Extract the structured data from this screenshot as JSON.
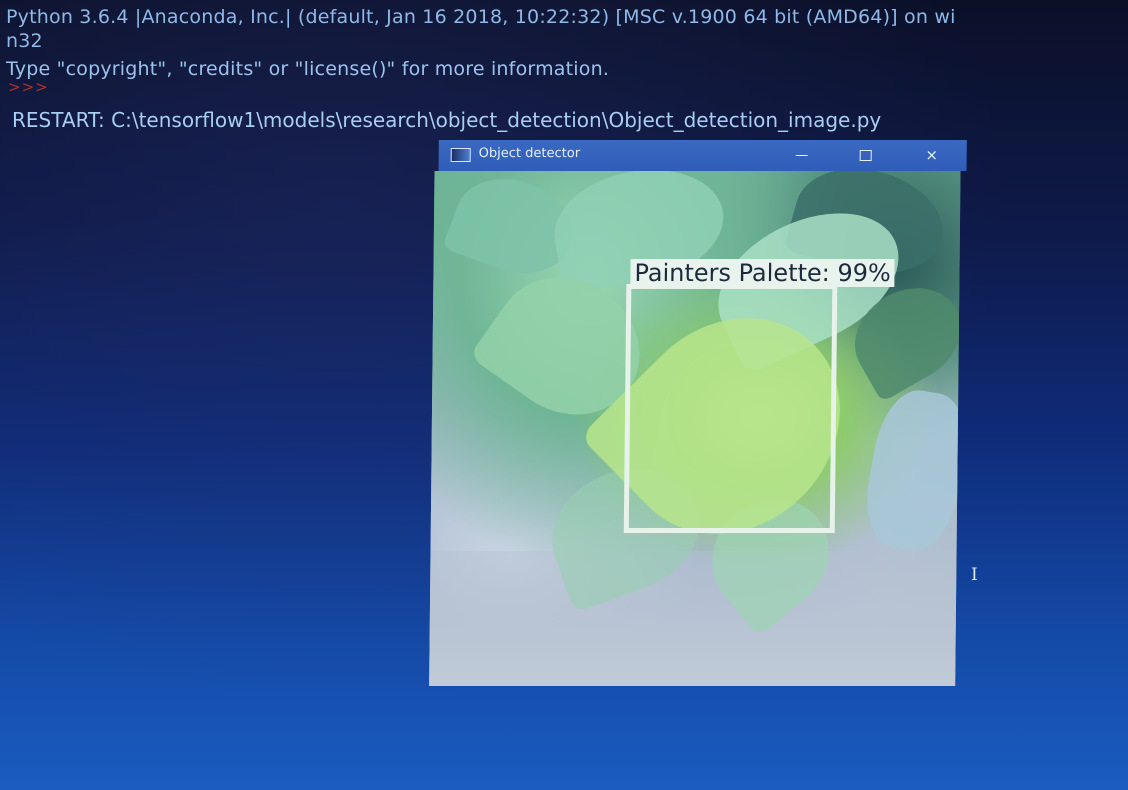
{
  "console": {
    "line1": "Python 3.6.4 |Anaconda, Inc.| (default, Jan 16 2018, 10:22:32) [MSC v.1900 64 bit (AMD64)] on wi",
    "line2": "n32",
    "line3": "Type \"copyright\", \"credits\" or \"license()\" for more information.",
    "prompt": ">>>",
    "restart": "RESTART: C:\\tensorflow1\\models\\research\\object_detection\\Object_detection_image.py"
  },
  "window": {
    "title": "Object detector",
    "icon": "app-window-icon",
    "controls": {
      "minimize": "minimize-icon",
      "maximize": "maximize-icon",
      "close": "×"
    }
  },
  "detection": {
    "label": "Painters Palette: 99%",
    "box_color": "#e6f2ea"
  },
  "cursor": {
    "glyph": "I"
  },
  "colors": {
    "console_text": "#8fb9e8",
    "prompt": "#c0392b",
    "titlebar": "#2f5db7"
  }
}
